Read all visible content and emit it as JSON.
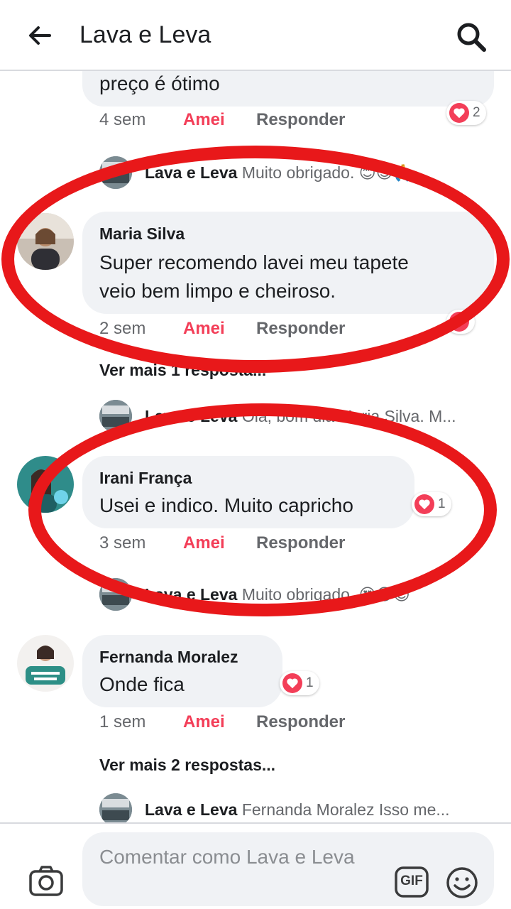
{
  "header": {
    "title": "Lava e Leva"
  },
  "comments": [
    {
      "text": "preço é ótimo",
      "time": "4 sem",
      "reactions": "2",
      "reply": {
        "author": "Lava e Leva",
        "text": "Muito obrigado. 😊😍🙏..."
      }
    },
    {
      "author": "Maria Silva",
      "lines": [
        "Super recomendo lavei meu tapete",
        "veio bem limpo e cheiroso."
      ],
      "time": "2 sem",
      "more_replies": "Ver mais 1 resposta...",
      "reply": {
        "author": "Lava e Leva",
        "text": "Olá, bom dia Maria Silva. M..."
      }
    },
    {
      "author": "Irani França",
      "text": "Usei e indico. Muito capricho",
      "time": "3 sem",
      "reactions": "1",
      "reply": {
        "author": "Lava e Leva",
        "text": "Muito obrigado. 😍😍😍"
      }
    },
    {
      "author": "Fernanda Moralez",
      "text": "Onde fica",
      "time": "1 sem",
      "reactions": "1",
      "more_replies": "Ver mais 2 respostas...",
      "reply": {
        "author": "Lava e Leva",
        "text": "Fernanda Moralez Isso me..."
      }
    }
  ],
  "actions": {
    "like": "Amei",
    "reply": "Responder"
  },
  "composer": {
    "placeholder": "Comentar como Lava e Leva",
    "gif": "GIF"
  },
  "colors": {
    "highlight": "#e8181a",
    "love": "#f33e58",
    "bubble": "#f0f2f5"
  }
}
